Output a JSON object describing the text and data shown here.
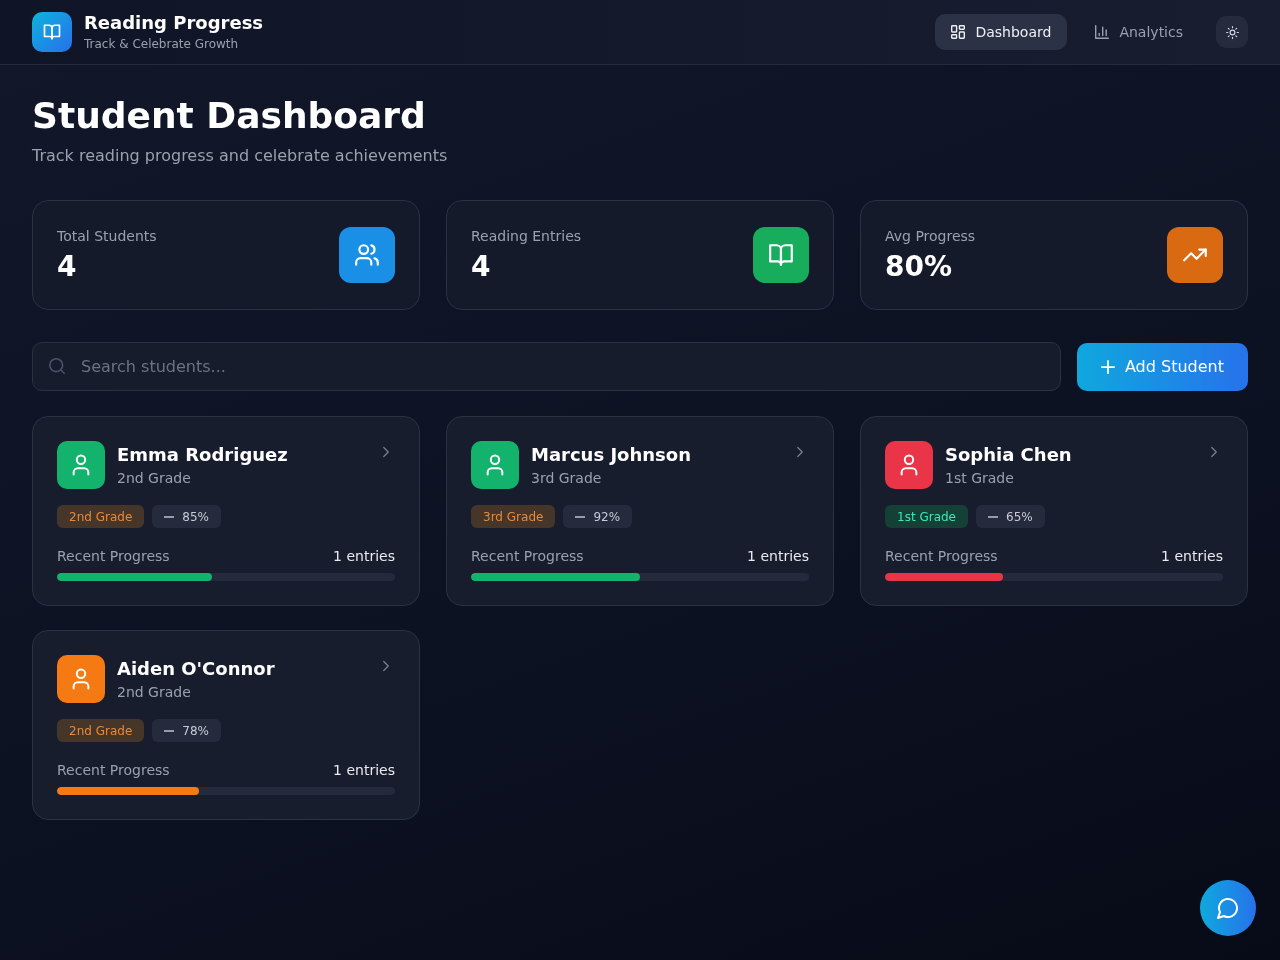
{
  "header": {
    "title": "Reading Progress",
    "subtitle": "Track & Celebrate Growth",
    "nav": [
      {
        "label": "Dashboard",
        "selected": true
      },
      {
        "label": "Analytics",
        "selected": false
      }
    ]
  },
  "page": {
    "title": "Student Dashboard",
    "subtitle": "Track reading progress and celebrate achievements"
  },
  "stats": [
    {
      "label": "Total Students",
      "value": "4",
      "color": "#1a8fe6"
    },
    {
      "label": "Reading Entries",
      "value": "4",
      "color": "#17ad5c"
    },
    {
      "label": "Avg Progress",
      "value": "80%",
      "color": "#d96a12"
    }
  ],
  "search": {
    "placeholder": "Search students..."
  },
  "add_button": {
    "label": "Add Student"
  },
  "students": [
    {
      "name": "Emma Rodriguez",
      "grade": "2nd Grade",
      "tag": {
        "label": "2nd Grade",
        "color": "#463629"
      },
      "score": "85%",
      "progress_label": "Recent Progress",
      "entries": "1 entries",
      "level": 0.46,
      "color": "#13b26d"
    },
    {
      "name": "Marcus Johnson",
      "grade": "3rd Grade",
      "tag": {
        "label": "3rd Grade",
        "color": "#463629"
      },
      "score": "92%",
      "progress_label": "Recent Progress",
      "entries": "1 entries",
      "level": 0.5,
      "color": "#13b26d"
    },
    {
      "name": "Sophia Chen",
      "grade": "1st Grade",
      "tag": {
        "label": "1st Grade",
        "color": "#154035"
      },
      "score": "65%",
      "progress_label": "Recent Progress",
      "entries": "1 entries",
      "level": 0.35,
      "color": "#ea3548"
    },
    {
      "name": "Aiden O'Connor",
      "grade": "2nd Grade",
      "tag": {
        "label": "2nd Grade",
        "color": "#463629"
      },
      "score": "78%",
      "progress_label": "Recent Progress",
      "entries": "1 entries",
      "level": 0.42,
      "color": "#f57a14"
    }
  ]
}
